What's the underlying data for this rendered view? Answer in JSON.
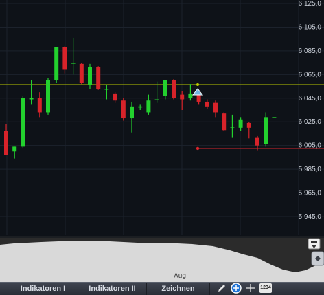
{
  "chart_data": {
    "type": "candlestick",
    "ylim": [
      5930,
      6125
    ],
    "y_ticks": [
      "6.125,0",
      "6.105,0",
      "6.085,0",
      "6.065,0",
      "6.045,0",
      "6.025,0",
      "6.005,0",
      "5.985,0",
      "5.965,0",
      "5.945,0"
    ],
    "x_labels": [
      "Aug"
    ],
    "horizontal_lines": [
      {
        "value": 6056.5,
        "color": "#b9c800"
      },
      {
        "value": 6002.5,
        "color": "#d8242b"
      }
    ],
    "candles": [
      {
        "o": 6017,
        "h": 6023,
        "l": 5997,
        "c": 5997,
        "dir": "down"
      },
      {
        "o": 6000,
        "h": 6004,
        "l": 5994,
        "c": 6004,
        "dir": "up"
      },
      {
        "o": 6004,
        "h": 6047,
        "l": 6003,
        "c": 6045,
        "dir": "up"
      },
      {
        "o": 6044,
        "h": 6060,
        "l": 6040,
        "c": 6045,
        "dir": "up"
      },
      {
        "o": 6045,
        "h": 6050,
        "l": 6029,
        "c": 6033,
        "dir": "down"
      },
      {
        "o": 6033,
        "h": 6062,
        "l": 6031,
        "c": 6060,
        "dir": "up"
      },
      {
        "o": 6060,
        "h": 6088,
        "l": 6058,
        "c": 6088,
        "dir": "up"
      },
      {
        "o": 6088,
        "h": 6089,
        "l": 6066,
        "c": 6069,
        "dir": "down"
      },
      {
        "o": 6075,
        "h": 6096,
        "l": 6065,
        "c": 6075,
        "dir": "up"
      },
      {
        "o": 6074,
        "h": 6075,
        "l": 6057,
        "c": 6058,
        "dir": "down"
      },
      {
        "o": 6056,
        "h": 6074,
        "l": 6053,
        "c": 6071,
        "dir": "up"
      },
      {
        "o": 6071,
        "h": 6072,
        "l": 6052,
        "c": 6053,
        "dir": "down"
      },
      {
        "o": 6053,
        "h": 6056,
        "l": 6044,
        "c": 6053,
        "dir": "up"
      },
      {
        "o": 6049,
        "h": 6050,
        "l": 6041,
        "c": 6043,
        "dir": "down"
      },
      {
        "o": 6043,
        "h": 6045,
        "l": 6026,
        "c": 6028,
        "dir": "down"
      },
      {
        "o": 6028,
        "h": 6042,
        "l": 6016,
        "c": 6038,
        "dir": "up"
      },
      {
        "o": 6038,
        "h": 6040,
        "l": 6035,
        "c": 6038,
        "dir": "up"
      },
      {
        "o": 6033,
        "h": 6048,
        "l": 6031,
        "c": 6043,
        "dir": "up"
      },
      {
        "o": 6044,
        "h": 6059,
        "l": 6041,
        "c": 6044,
        "dir": "up"
      },
      {
        "o": 6047,
        "h": 6060,
        "l": 6044,
        "c": 6060,
        "dir": "up"
      },
      {
        "o": 6060,
        "h": 6061,
        "l": 6044,
        "c": 6045,
        "dir": "down"
      },
      {
        "o": 6048,
        "h": 6051,
        "l": 6035,
        "c": 6044,
        "dir": "down"
      },
      {
        "o": 6045,
        "h": 6057,
        "l": 6043,
        "c": 6049,
        "dir": "up"
      },
      {
        "o": 6049,
        "h": 6050,
        "l": 6040,
        "c": 6042,
        "dir": "down"
      },
      {
        "o": 6042,
        "h": 6044,
        "l": 6036,
        "c": 6038,
        "dir": "down"
      },
      {
        "o": 6041,
        "h": 6043,
        "l": 6029,
        "c": 6033,
        "dir": "down"
      },
      {
        "o": 6032,
        "h": 6033,
        "l": 6017,
        "c": 6018,
        "dir": "down"
      },
      {
        "o": 6021,
        "h": 6031,
        "l": 6012,
        "c": 6021,
        "dir": "up"
      },
      {
        "o": 6020,
        "h": 6029,
        "l": 6017,
        "c": 6027,
        "dir": "up"
      },
      {
        "o": 6024,
        "h": 6025,
        "l": 6011,
        "c": 6020,
        "dir": "down"
      },
      {
        "o": 6012,
        "h": 6013,
        "l": 6001,
        "c": 6005,
        "dir": "down"
      },
      {
        "o": 6006,
        "h": 6033,
        "l": 6004,
        "c": 6029,
        "dir": "up"
      },
      {
        "o": 6029,
        "h": 6029,
        "l": 6029,
        "c": 6029,
        "dir": "up"
      }
    ]
  },
  "toolbar": {
    "tabs": [
      "Indikatoren I",
      "Indikatoren II",
      "Zeichnen"
    ],
    "counter_label": "1234"
  },
  "colors": {
    "background": "#0e1218",
    "grid": "#1c222c",
    "up": "#23d12e",
    "down": "#d8232a",
    "axis_text": "#c9ced6"
  }
}
